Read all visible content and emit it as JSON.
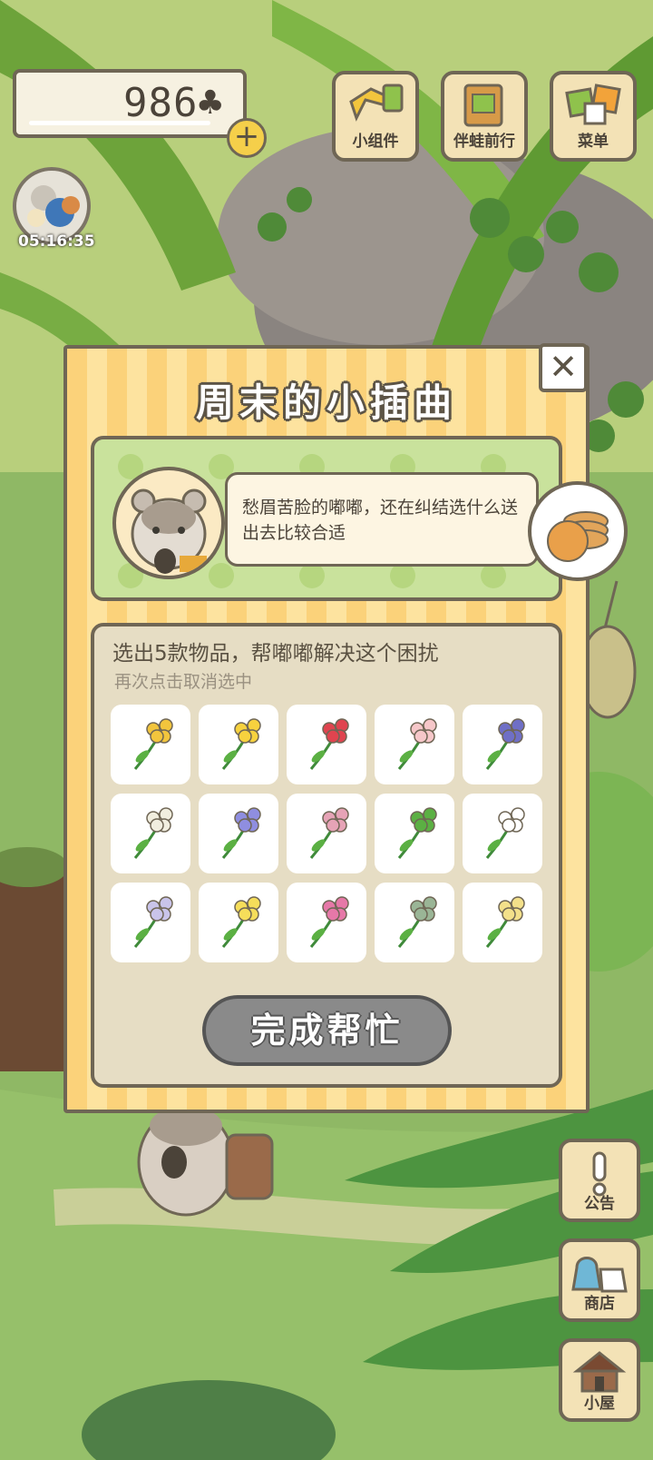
{
  "hud": {
    "clover_count": "986",
    "clover_symbol": "♣",
    "plus": "+",
    "timer": "05:16:35"
  },
  "top_buttons": [
    {
      "label": "小组件",
      "icon": "widget-icon"
    },
    {
      "label": "伴蛙前行",
      "icon": "journey-book-icon"
    },
    {
      "label": "菜单",
      "icon": "menu-cards-icon"
    }
  ],
  "side_buttons": [
    {
      "label": "公告",
      "icon": "exclamation-icon"
    },
    {
      "label": "商店",
      "icon": "shop-bags-icon"
    },
    {
      "label": "小屋",
      "icon": "house-icon"
    }
  ],
  "dialog": {
    "title": "周末的小插曲",
    "close": "✕",
    "speech": "愁眉苦脸的嘟嘟，还在纠结选什么送出去比较合适",
    "instruction": "选出5款物品，帮嘟嘟解决这个困扰",
    "hint": "再次点击取消选中",
    "done_button": "完成帮忙"
  },
  "items": [
    {
      "icon": "osmanthus-icon",
      "color": "#f2c53d"
    },
    {
      "icon": "yellow-tulip-icon",
      "color": "#f7d23e"
    },
    {
      "icon": "red-tulip-icon",
      "color": "#e0444f"
    },
    {
      "icon": "pink-tulip-icon",
      "color": "#f6c7c9"
    },
    {
      "icon": "iris-icon",
      "color": "#6f6fc6"
    },
    {
      "icon": "dandelion-puff-icon",
      "color": "#f1eedf"
    },
    {
      "icon": "hyacinth-icon",
      "color": "#8f8ee0"
    },
    {
      "icon": "pink-buds-icon",
      "color": "#e6a3b6"
    },
    {
      "icon": "four-leaf-clover-icon",
      "color": "#5bb043"
    },
    {
      "icon": "white-lily-icon",
      "color": "#ffffff"
    },
    {
      "icon": "lilac-icon",
      "color": "#c9c4ea"
    },
    {
      "icon": "buttercup-icon",
      "color": "#f6de5a"
    },
    {
      "icon": "hibiscus-icon",
      "color": "#e678a8"
    },
    {
      "icon": "sage-sprig-icon",
      "color": "#9ab596"
    },
    {
      "icon": "wintersweet-icon",
      "color": "#f3e08a"
    }
  ],
  "colors": {
    "dialog_stripe_a": "#fbd27a",
    "dialog_stripe_b": "#fde39f",
    "outline": "#6f6655",
    "button_disabled": "#8a8a8a"
  }
}
